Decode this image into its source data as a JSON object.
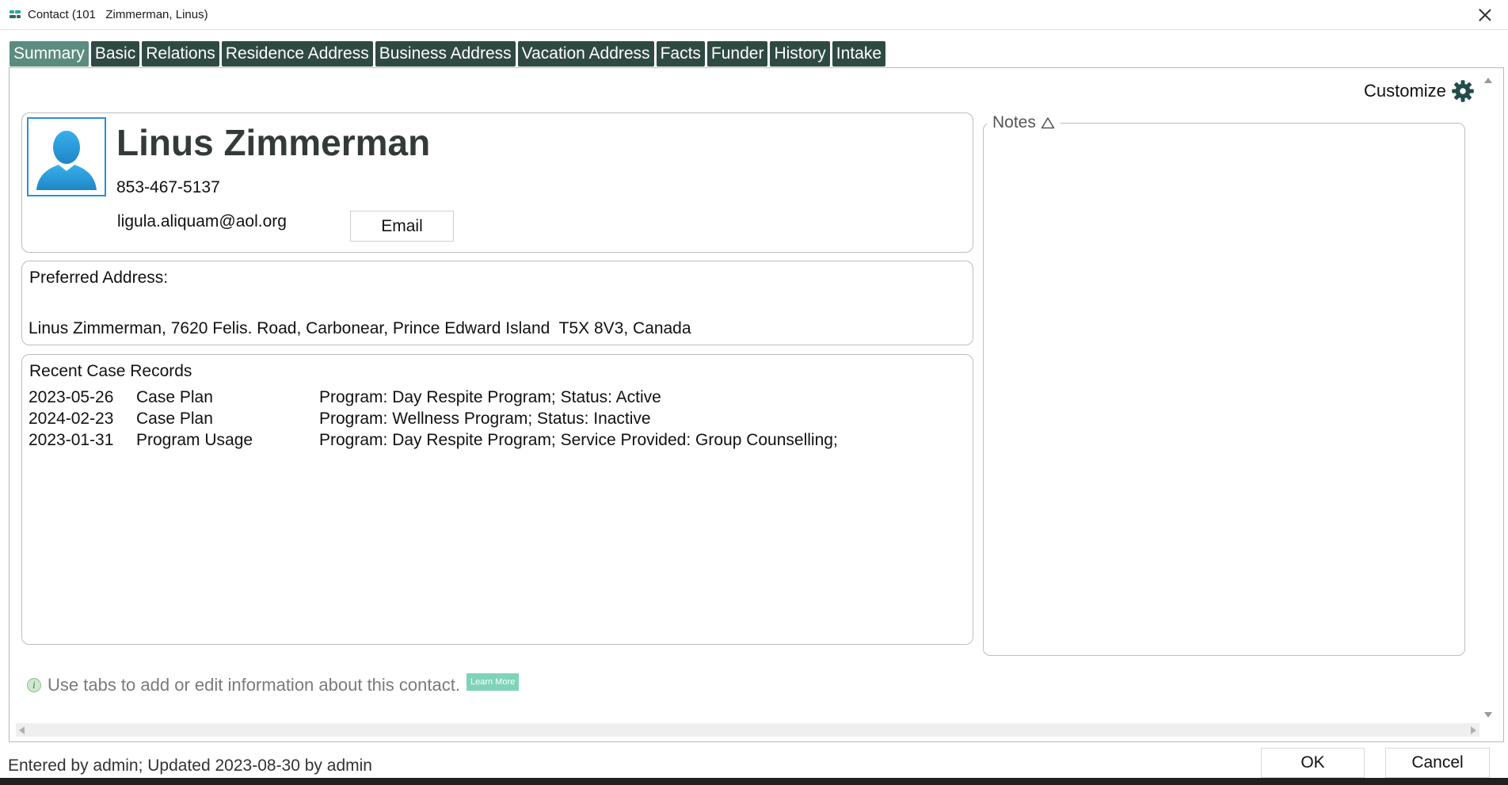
{
  "window": {
    "title": "Contact (101   Zimmerman, Linus)",
    "close_icon": "close-icon"
  },
  "tabs": [
    {
      "label": "Summary",
      "active": true
    },
    {
      "label": "Basic",
      "active": false
    },
    {
      "label": "Relations",
      "active": false
    },
    {
      "label": "Residence Address",
      "active": false
    },
    {
      "label": "Business Address",
      "active": false
    },
    {
      "label": "Vacation Address",
      "active": false
    },
    {
      "label": "Facts",
      "active": false
    },
    {
      "label": "Funder",
      "active": false
    },
    {
      "label": "History",
      "active": false
    },
    {
      "label": "Intake",
      "active": false
    }
  ],
  "customize": {
    "label": "Customize",
    "icon": "gear-icon"
  },
  "contact": {
    "name": "Linus Zimmerman",
    "phone": "853-467-5137",
    "email": "ligula.aliquam@aol.org",
    "email_button": "Email",
    "avatar_icon": "person-silhouette-icon"
  },
  "address": {
    "label": "Preferred Address:",
    "value": "Linus Zimmerman, 7620 Felis. Road, Carbonear, Prince Edward Island  T5X 8V3, Canada"
  },
  "records": {
    "title": "Recent Case Records",
    "rows": [
      {
        "date": "2023-05-26",
        "type": "Case Plan",
        "description": "Program: Day Respite Program; Status: Active"
      },
      {
        "date": "2024-02-23",
        "type": "Case Plan",
        "description": "Program: Wellness Program; Status: Inactive"
      },
      {
        "date": "2023-01-31",
        "type": "Program Usage",
        "description": "Program: Day Respite Program; Service Provided: Group Counselling;"
      }
    ]
  },
  "notes": {
    "label": "Notes",
    "icon": "warning-triangle-icon"
  },
  "hint": {
    "text": "Use tabs to add or edit information about this contact.",
    "learn_more": "Learn More",
    "icon": "info-icon"
  },
  "footer": {
    "status": "Entered by admin; Updated 2023-08-30 by admin",
    "ok": "OK",
    "cancel": "Cancel"
  },
  "colors": {
    "tab_bg": "#2f4a43",
    "tab_active_bg": "#5b8c7f",
    "gear": "#234b4a",
    "avatar_border": "#2d8fd6",
    "avatar_fill": "#2a9bd8",
    "learn_more_bg": "#7fd3b8"
  }
}
